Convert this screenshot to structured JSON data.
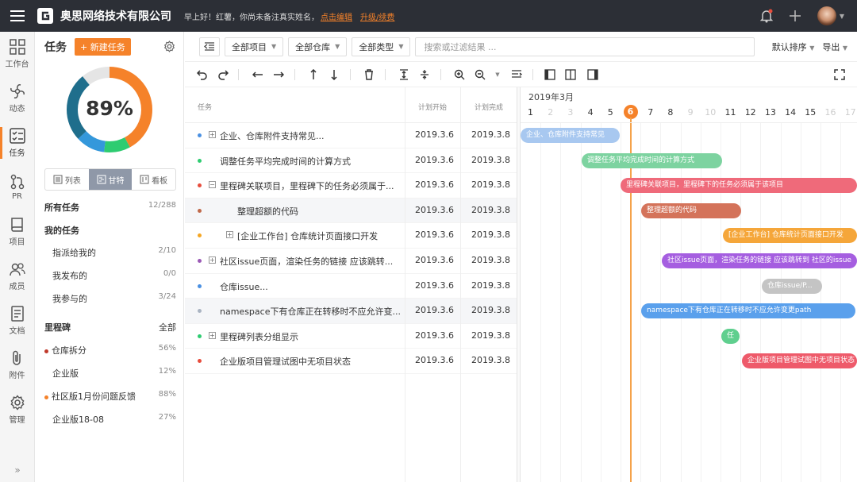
{
  "topbar": {
    "company": "奥思网络技术有限公司",
    "greeting": "早上好！红薯，你尚未备注真实姓名，",
    "edit_link": "点击编辑",
    "upgrade_link": "升级/续费"
  },
  "sidebar": {
    "items": [
      {
        "label": "工作台",
        "icon": "workbench-icon"
      },
      {
        "label": "动态",
        "icon": "activity-icon"
      },
      {
        "label": "任务",
        "icon": "task-icon"
      },
      {
        "label": "PR",
        "icon": "pull-request-icon"
      },
      {
        "label": "项目",
        "icon": "project-icon"
      },
      {
        "label": "成员",
        "icon": "members-icon"
      },
      {
        "label": "文档",
        "icon": "document-icon"
      },
      {
        "label": "附件",
        "icon": "attachment-icon"
      },
      {
        "label": "管理",
        "icon": "settings-icon"
      }
    ],
    "expand": "»"
  },
  "left_panel": {
    "title": "任务",
    "new_task": "+ 新建任务",
    "progress_label": "89%",
    "progress_value": 0.89,
    "views": [
      {
        "label": "列表"
      },
      {
        "label": "甘特"
      },
      {
        "label": "看板"
      }
    ],
    "all_tasks": {
      "label": "所有任务",
      "count": "12/288"
    },
    "my_tasks": {
      "label": "我的任务"
    },
    "assigned": {
      "label": "指派给我的",
      "count": "2/10"
    },
    "published": {
      "label": "我发布的",
      "count": "0/0"
    },
    "joined": {
      "label": "我参与的",
      "count": "3/24"
    },
    "milestone": {
      "label": "里程碑",
      "all": "全部"
    },
    "milestones": [
      {
        "label": "仓库拆分",
        "percent": "56%",
        "color": "#c0392b"
      },
      {
        "label": "企业版",
        "percent": "12%",
        "color": ""
      },
      {
        "label": "社区版1月份问题反馈",
        "percent": "88%",
        "color": "#f5822a"
      },
      {
        "label": "企业版18-08",
        "percent": "27%",
        "color": ""
      }
    ]
  },
  "toolbar": {
    "filters": [
      "全部项目",
      "全部仓库",
      "全部类型"
    ],
    "search_placeholder": "搜索或过滤结果 ...",
    "sort": "默认排序",
    "export": "导出"
  },
  "table": {
    "headers": {
      "task": "任务",
      "start": "计划开始",
      "end": "计划完成"
    },
    "rows": [
      {
        "name": "企业、仓库附件支持常见...",
        "start": "2019.3.6",
        "end": "2019.3.8",
        "dot": "#4a90e2",
        "box": "+"
      },
      {
        "name": "调整任务平均完成时间的计算方式",
        "start": "2019.3.6",
        "end": "2019.3.8",
        "dot": "#2ecc71",
        "box": ""
      },
      {
        "name": "里程碑关联项目，里程碑下的任务必须属于...",
        "start": "2019.3.6",
        "end": "2019.3.8",
        "dot": "#e74c3c",
        "box": "−"
      },
      {
        "name": "整理超额的代码",
        "start": "2019.3.6",
        "end": "2019.3.8",
        "dot": "#c0694a",
        "box": ""
      },
      {
        "name": "[企业工作台] 仓库统计页面接口开发",
        "start": "2019.3.6",
        "end": "2019.3.8",
        "dot": "#f5a623",
        "box": "+"
      },
      {
        "name": "社区issue页面，渲染任务的链接 应该跳转...",
        "start": "2019.3.6",
        "end": "2019.3.8",
        "dot": "#9b59b6",
        "box": "+"
      },
      {
        "name": "仓库issue...",
        "start": "2019.3.6",
        "end": "2019.3.8",
        "dot": "#4a90e2",
        "box": ""
      },
      {
        "name": "namespace下有仓库正在转移时不应允许变...",
        "start": "2019.3.6",
        "end": "2019.3.8",
        "dot": "#aab4c2",
        "box": ""
      },
      {
        "name": "里程碑列表分组显示",
        "start": "2019.3.6",
        "end": "2019.3.8",
        "dot": "#2ecc71",
        "box": "+"
      },
      {
        "name": "企业版项目管理试图中无项目状态",
        "start": "2019.3.6",
        "end": "2019.3.8",
        "dot": "#e74c3c",
        "box": ""
      }
    ]
  },
  "gantt": {
    "month": "2019年3月",
    "days": [
      "1",
      "2",
      "3",
      "4",
      "5",
      "6",
      "7",
      "8",
      "9",
      "10",
      "11",
      "12",
      "13",
      "14",
      "15",
      "16",
      "17"
    ],
    "weekend_days": [
      "2",
      "3",
      "9",
      "10",
      "16",
      "17"
    ],
    "today": "6",
    "bars": [
      {
        "label": "企业、仓库附件支持常见",
        "color": "#a8c8f0"
      },
      {
        "label": "调整任务平均完成时间的计算方式",
        "color": "#7dd3a0"
      },
      {
        "label": "里程碑关联项目，里程碑下的任务必须属于该项目",
        "color": "#ef6a7a"
      },
      {
        "label": "整理超额的代码",
        "color": "#d4735a"
      },
      {
        "label": "[企业工作台] 仓库统计页面接口开发",
        "color": "#f5a63a"
      },
      {
        "label": "社区issue页面，渲染任务的链接 应该跳转到 社区的issue",
        "color": "#a55ee0"
      },
      {
        "label": "仓库issue/P...",
        "color": "#c4c4c4"
      },
      {
        "label": "namespace下有仓库正在转移时不应允许变更path",
        "color": "#5aa0ec"
      },
      {
        "label": "任",
        "color": "#5fcf8e"
      },
      {
        "label": "企业版项目管理试图中无项目状态",
        "color": "#ee5a6a"
      }
    ]
  }
}
